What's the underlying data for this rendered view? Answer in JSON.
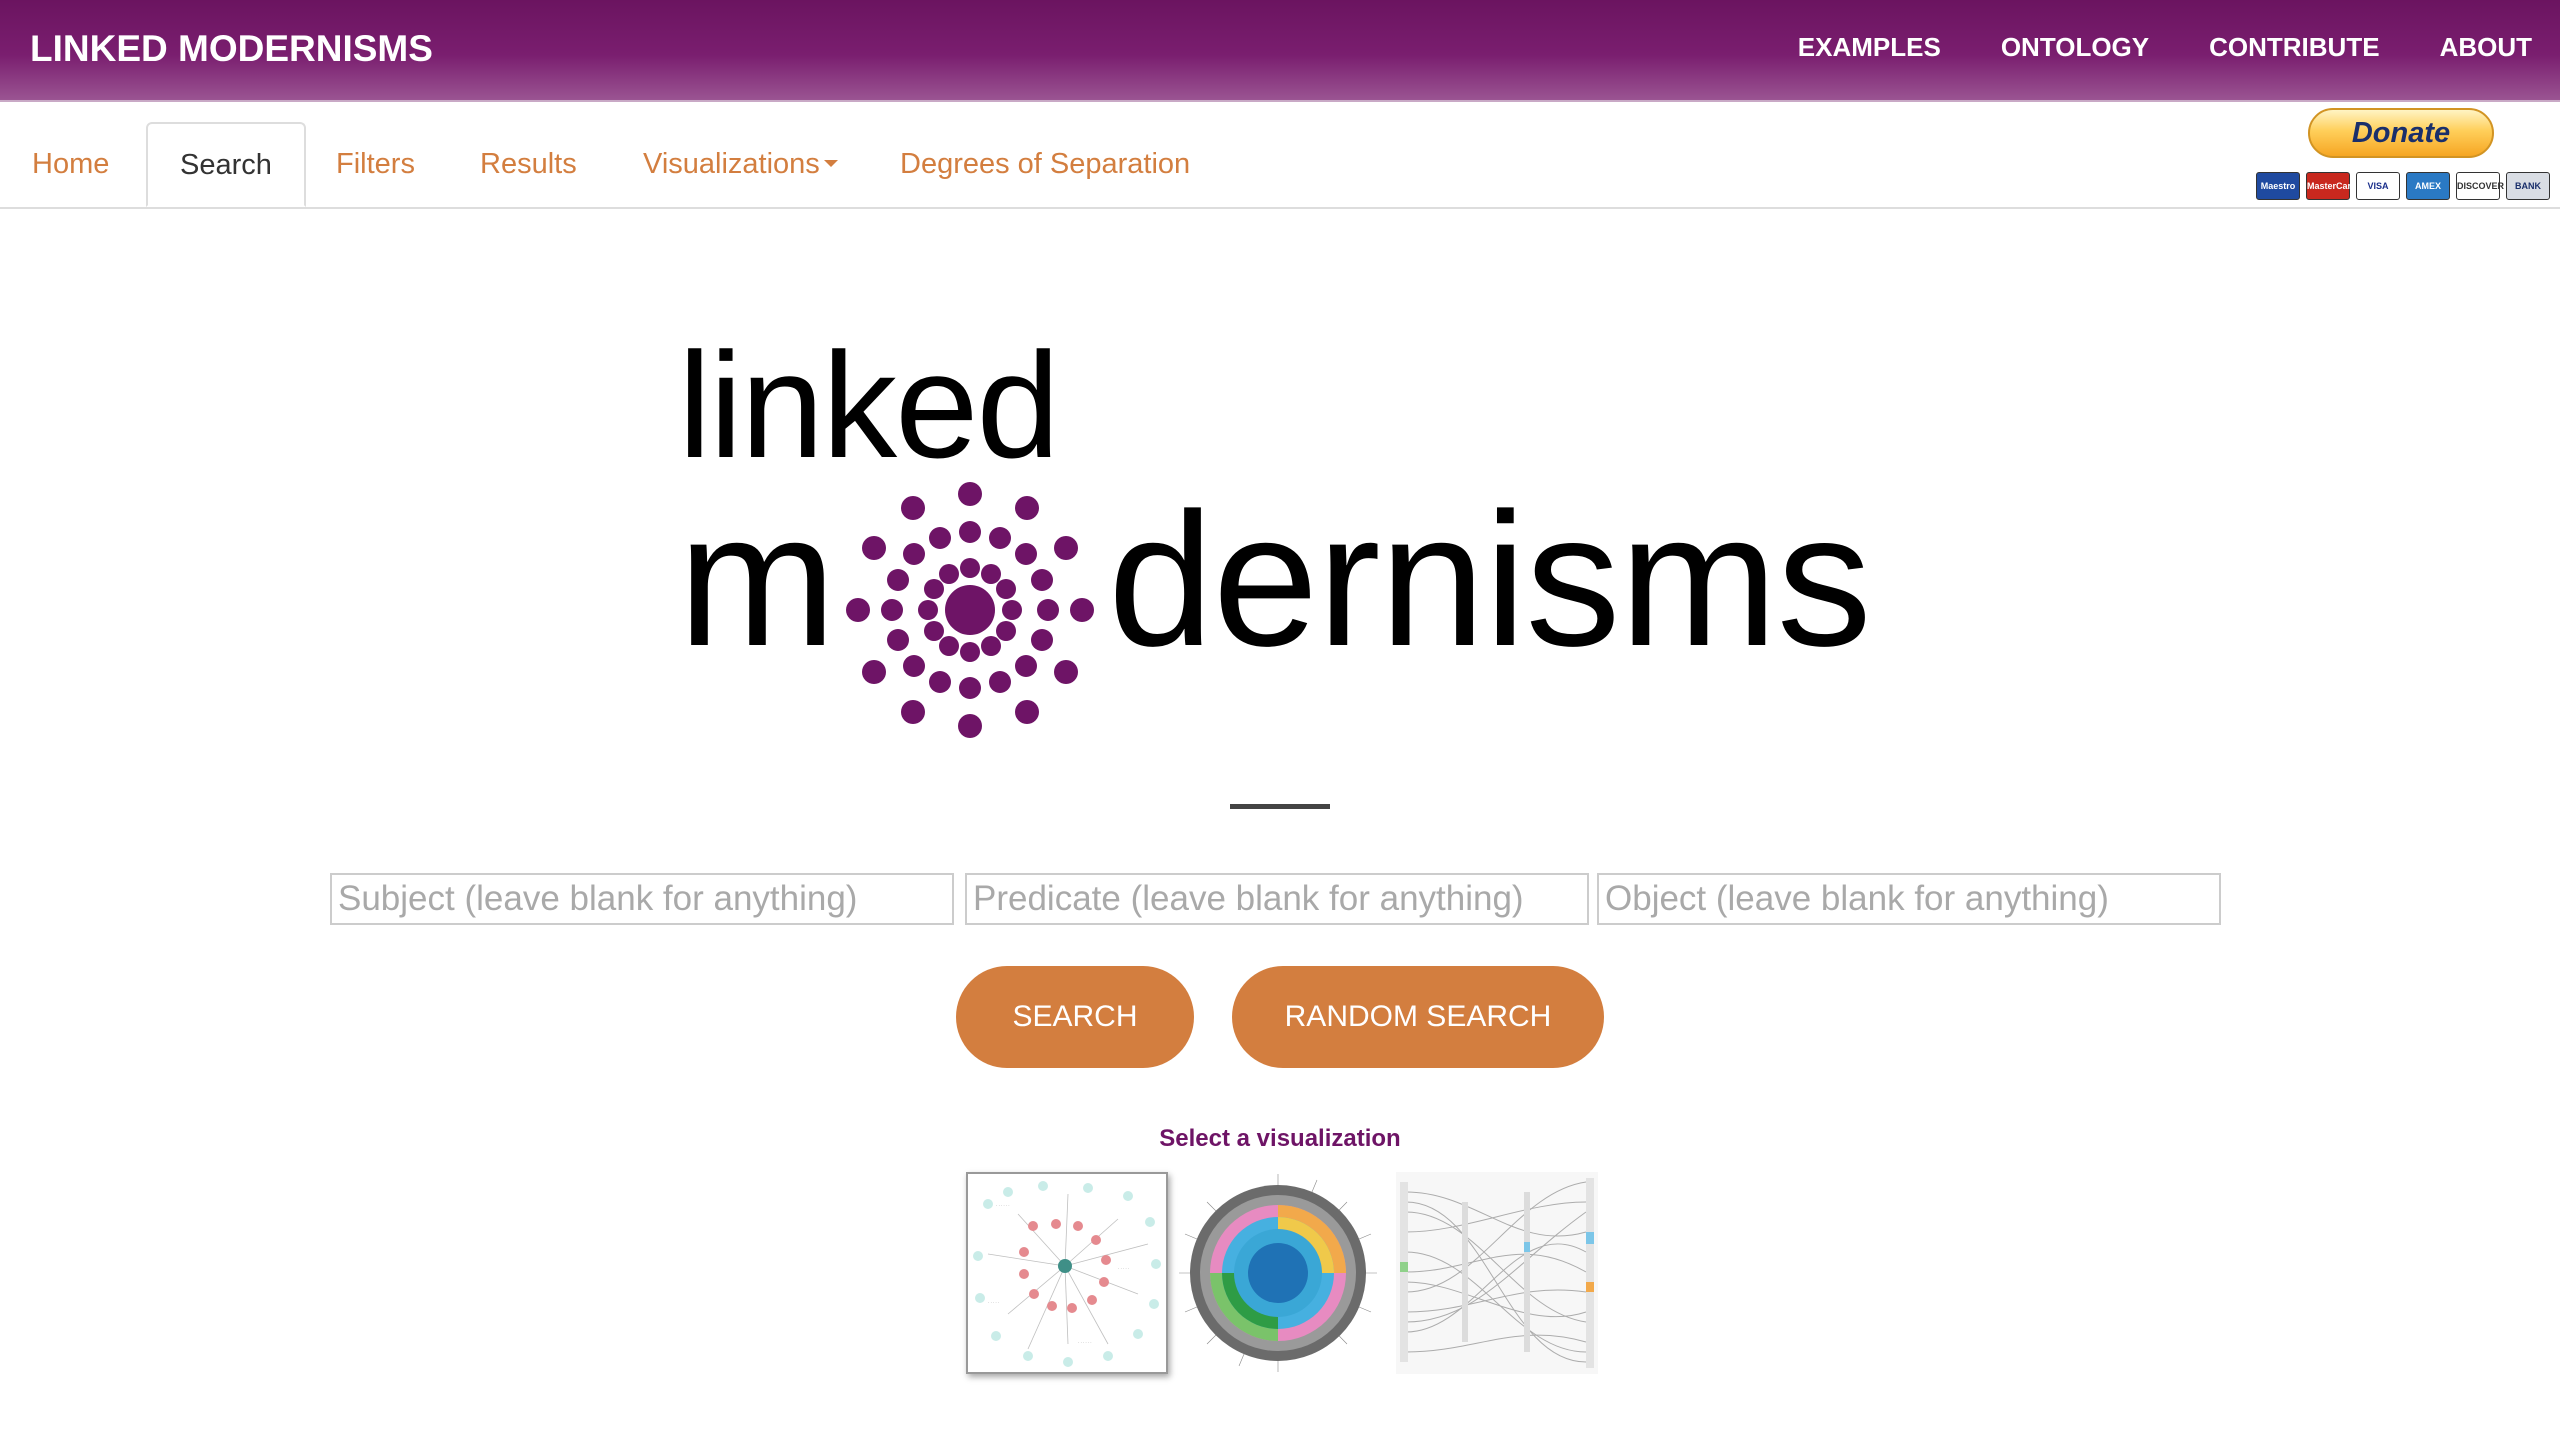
{
  "header": {
    "brand": "LINKED MODERNISMS",
    "nav": [
      "EXAMPLES",
      "ONTOLOGY",
      "CONTRIBUTE",
      "ABOUT"
    ]
  },
  "tabs": {
    "home": "Home",
    "search": "Search",
    "filters": "Filters",
    "results": "Results",
    "visualizations": "Visualizations",
    "degrees": "Degrees of Separation",
    "active": "Search"
  },
  "donate": {
    "label": "Donate",
    "cards": [
      "Maestro",
      "MasterCard",
      "VISA",
      "AMEX",
      "DISCOVER",
      "BANK"
    ]
  },
  "logo": {
    "line1": "linked",
    "m": "m",
    "rest": "dernisms",
    "color": "#6e1466"
  },
  "search": {
    "subject_placeholder": "Subject (leave blank for anything)",
    "predicate_placeholder": "Predicate (leave blank for anything)",
    "object_placeholder": "Object (leave blank for anything)",
    "subject_value": "",
    "predicate_value": "",
    "object_value": "",
    "search_button": "SEARCH",
    "random_button": "RANDOM SEARCH"
  },
  "visualizations": {
    "label": "Select a visualization",
    "options": [
      "network-graph-icon",
      "sunburst-chart-icon",
      "parallel-paths-icon"
    ],
    "selected": 0
  },
  "colors": {
    "header_purple": "#7a1e6f",
    "accent_orange": "#d37e3f",
    "logo_purple": "#6e1466"
  }
}
